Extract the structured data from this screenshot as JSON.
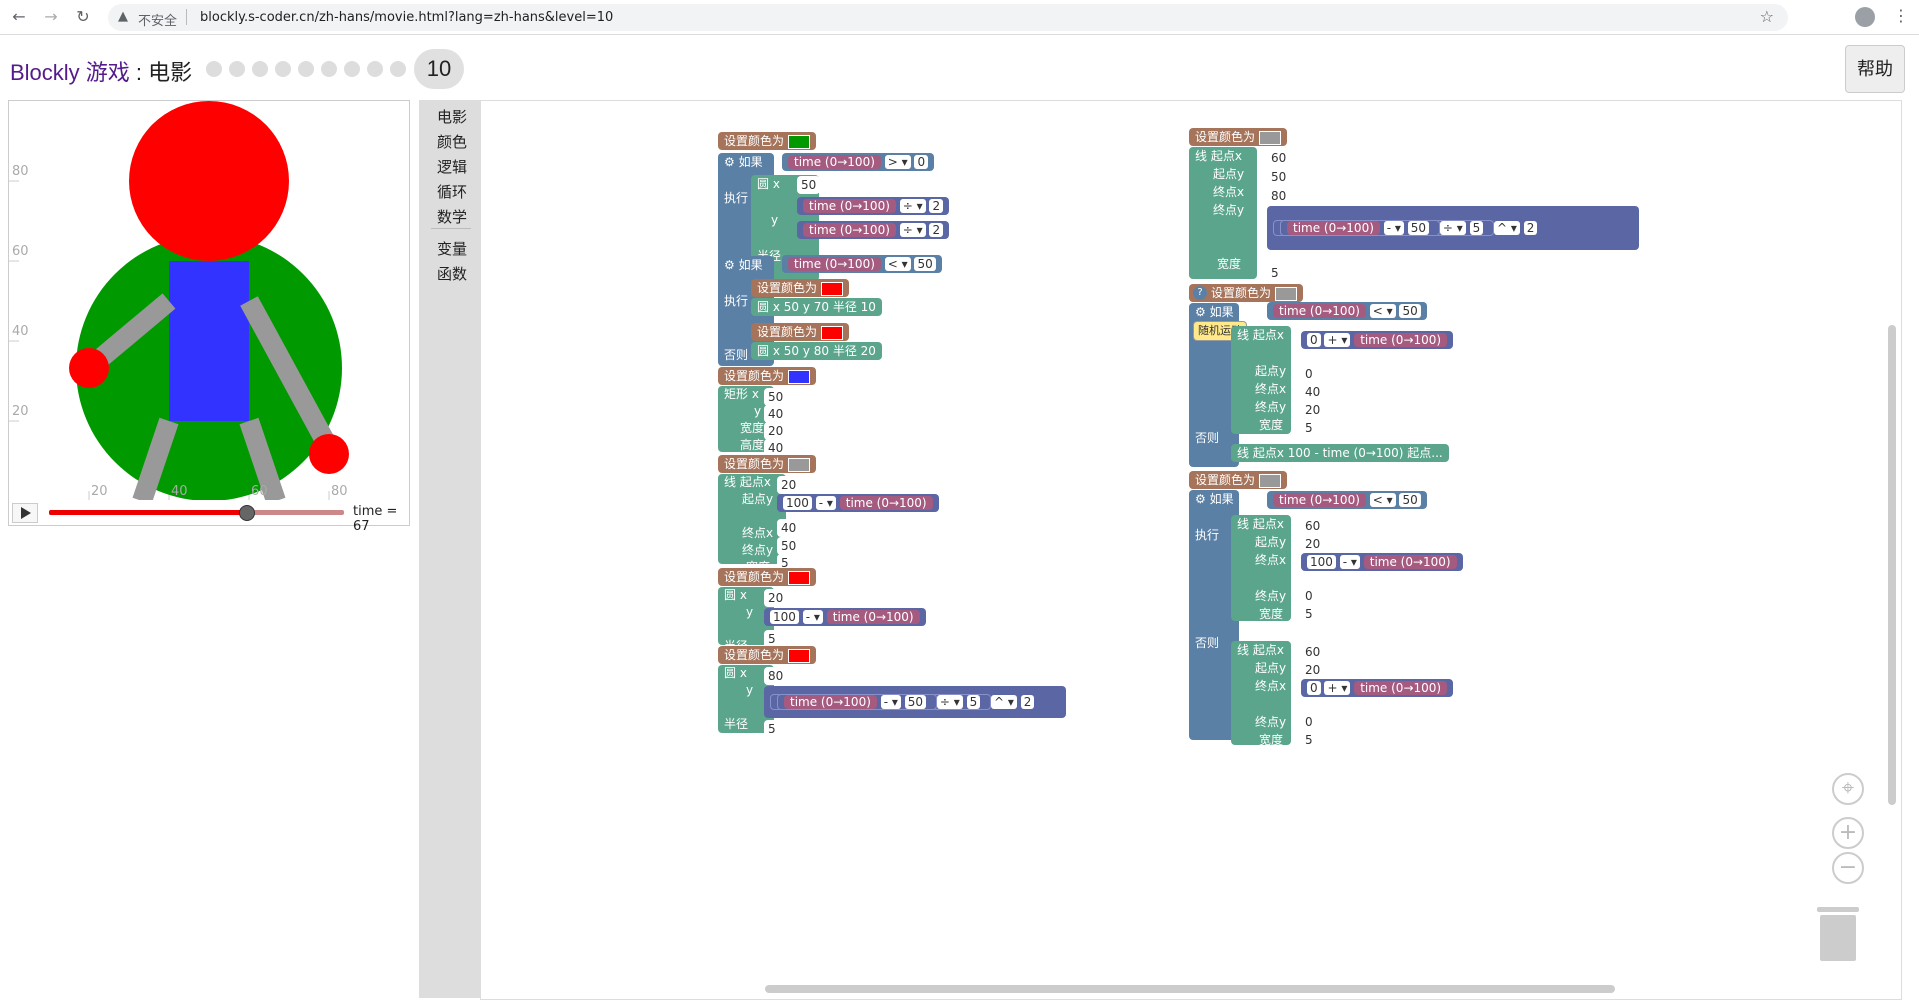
{
  "browser": {
    "back_icon": "back-arrow-icon",
    "forward_icon": "forward-arrow-icon",
    "reload_icon": "reload-icon",
    "security_label": "不安全",
    "url": "blockly.s-coder.cn/zh-hans/movie.html?lang=zh-hans&level=10",
    "bookmark_icon": "star-icon",
    "menu_icon": "kebab-menu-icon"
  },
  "header": {
    "brand": "Blockly 游戏",
    "separator": " : ",
    "game": "电影",
    "current_level": "10",
    "total_levels": 10,
    "help_label": "帮助"
  },
  "display": {
    "y_ticks": [
      "80",
      "60",
      "40",
      "20"
    ],
    "x_ticks": [
      "20",
      "40",
      "60",
      "80"
    ],
    "time_label": "time = 67",
    "time_value": 67,
    "colors": {
      "head": "#ff0000",
      "body_circle": "#009900",
      "torso": "#3333ff",
      "limbs": "#999999",
      "hand": "#ff0000"
    }
  },
  "toolbox": {
    "categories": [
      "电影",
      "颜色",
      "逻辑",
      "循环",
      "数学",
      "变量",
      "函数"
    ]
  },
  "blocks": {
    "set_color": "设置颜色为",
    "if": "如果",
    "do": "执行",
    "else": "否则",
    "circle": "圆",
    "rect": "矩形",
    "line": "线",
    "x": "x",
    "y": "y",
    "radius": "半径",
    "width": "宽度",
    "height": "高度",
    "x1": "起点x",
    "y1": "起点y",
    "x2": "终点x",
    "y2": "终点y",
    "time": "time (0→100)",
    "circle_70": "圆 x 50 y 70 半径 10",
    "circle_80": "圆 x 50 y 80 半径 20",
    "line_collapsed": "线 起点x 100 - time (0→100) 起点...",
    "tooltip": "随机运动",
    "nums": {
      "n0": "0",
      "n2": "2",
      "n5": "5",
      "n20": "20",
      "n40": "40",
      "n50": "50",
      "n60": "60",
      "n80": "80",
      "n100": "100"
    },
    "ops": {
      "gt": "> ▾",
      "lt": "< ▾",
      "div": "÷ ▾",
      "minus": "- ▾",
      "plus": "+ ▾",
      "pow": "^ ▾"
    }
  },
  "block_colors": {
    "movie": "#5ba58c",
    "color": "#a5745b",
    "logic": "#5b80a5",
    "math": "#5b67a5",
    "time": "#a55b80"
  }
}
